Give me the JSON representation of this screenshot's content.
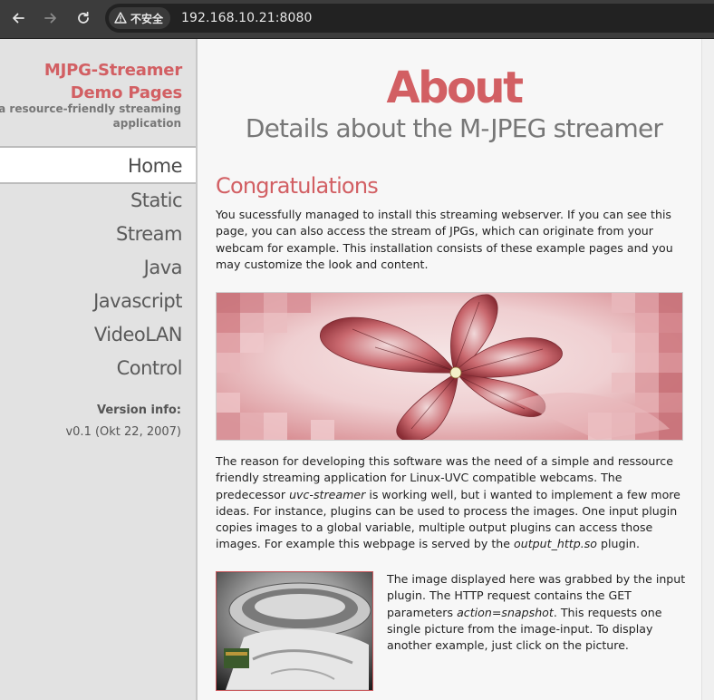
{
  "browser": {
    "security_label": "不安全",
    "url": "192.168.10.21:8080"
  },
  "sidebar": {
    "brand_line1": "MJPG-Streamer",
    "brand_line2": "Demo Pages",
    "tagline_line1": "a resource-friendly streaming",
    "tagline_line2": "application",
    "menu": [
      {
        "label": "Home",
        "active": true
      },
      {
        "label": "Static"
      },
      {
        "label": "Stream"
      },
      {
        "label": "Java"
      },
      {
        "label": "Javascript"
      },
      {
        "label": "VideoLAN"
      },
      {
        "label": "Control"
      }
    ],
    "version_label": "Version info:",
    "version_value": "v0.1 (Okt 22, 2007)"
  },
  "main": {
    "title": "About",
    "subtitle": "Details about the M-JPEG streamer",
    "section_heading": "Congratulations",
    "intro": "You sucessfully managed to install this streaming webserver. If you can see this page, you can also access the stream of JPGs, which can originate from your webcam for example. This installation consists of these example pages and you may customize the look and content.",
    "reason_1": "The reason for developing this software was the need of a simple and ressource friendly streaming application for Linux-UVC compatible webcams. The predecessor ",
    "reason_em1": "uvc-streamer",
    "reason_2": " is working well, but i wanted to implement a few more ideas. For instance, plugins can be used to process the images. One input plugin copies images to a global variable, multiple output plugins can access those images. For example this webpage is served by the ",
    "reason_em2": "output_http.so",
    "reason_3": " plugin.",
    "snapshot_1": "The image displayed here was grabbed by the input plugin. The HTTP request contains the GET parameters ",
    "snapshot_em": "action=snapshot",
    "snapshot_2": ". This requests one single picture from the image-input. To display another example, just click on the picture."
  },
  "colors": {
    "accent": "#d25f63",
    "sidebar_bg": "#e2e2e2",
    "chrome_bg": "#3c3c3c"
  },
  "icons": [
    "back-arrow-icon",
    "forward-arrow-icon",
    "reload-icon",
    "warning-icon"
  ]
}
